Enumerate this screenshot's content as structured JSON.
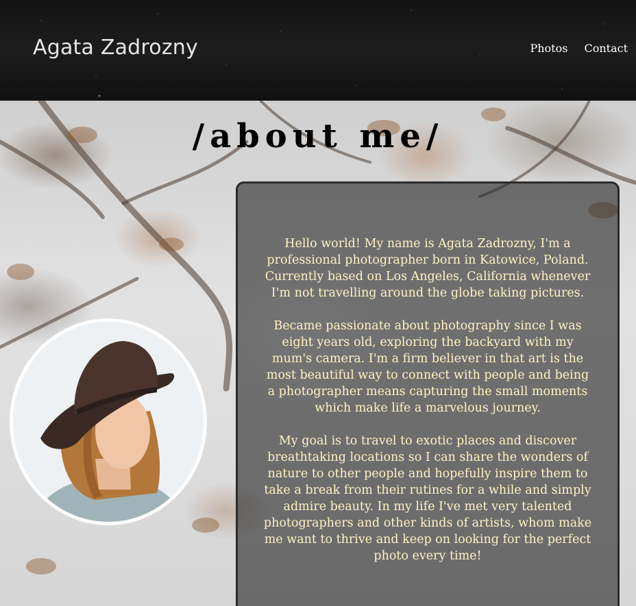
{
  "header": {
    "title": "Agata Zadrozny",
    "nav": [
      {
        "label": "Photos"
      },
      {
        "label": "Contact"
      }
    ]
  },
  "about": {
    "heading": "/about me/",
    "portrait_alt": "Portrait of a woman wearing a dark brown felt hat",
    "paragraphs": [
      "Hello world! My name is Agata Zadrozny, I'm a professional photographer born in Katowice, Poland. Currently based on Los Angeles, California whenever I'm not travelling around the globe taking pictures.",
      "Became passionate about photography since I was eight years old, exploring the backyard with my mum's camera. I'm a firm believer in that art is the most beautiful way to connect with people and being a photographer means capturing the small moments which make life a marvelous journey.",
      "My goal is to travel to exotic places and discover breathtaking locations so I can share the wonders of nature to other people and hopefully inspire them to take a break from their rutines for a while and simply admire beauty. In my life I've met very talented photographers and other kinds of artists, whom make me want to thrive and keep on looking for the perfect photo every time!"
    ]
  },
  "colors": {
    "header_bg": "#141414",
    "card_text": "#fff3c4",
    "card_bg": "rgba(40,40,40,0.62)"
  }
}
